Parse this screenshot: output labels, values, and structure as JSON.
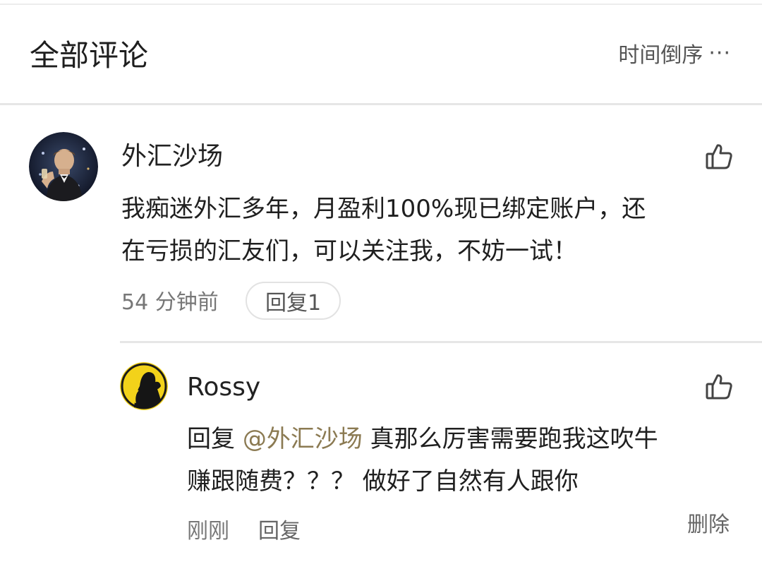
{
  "header": {
    "title": "全部评论",
    "sort_label": "时间倒序",
    "more_label": "···"
  },
  "comments": [
    {
      "username": "外汇沙场",
      "content_line1": "我痴迷外汇多年，月盈利100%现已绑定账户，还",
      "content_line2": "在亏损的汇友们，可以关注我，不妨一试！",
      "time": "54 分钟前",
      "reply_label": "回复1",
      "icons": {
        "avatar": "avatar-icon",
        "like": "thumbs-up-icon"
      }
    }
  ],
  "replies": [
    {
      "username": "Rossy",
      "reply_prefix": "回复",
      "mention": "@外汇沙场",
      "content_line1_rest": " 真那么厉害需要跑我这吹牛",
      "content_line2": "赚跟随费？？？ 做好了自然有人跟你",
      "time": "刚刚",
      "reply_label": "回复",
      "delete_label": "删除",
      "icons": {
        "avatar": "avatar-icon",
        "like": "thumbs-up-icon"
      }
    }
  ],
  "colors": {
    "text": "#1f1f1f",
    "muted": "#777777",
    "mention": "#8b7a52",
    "divider": "#e6e6e6",
    "rossy_avatar_bg": "#f2d21a"
  }
}
